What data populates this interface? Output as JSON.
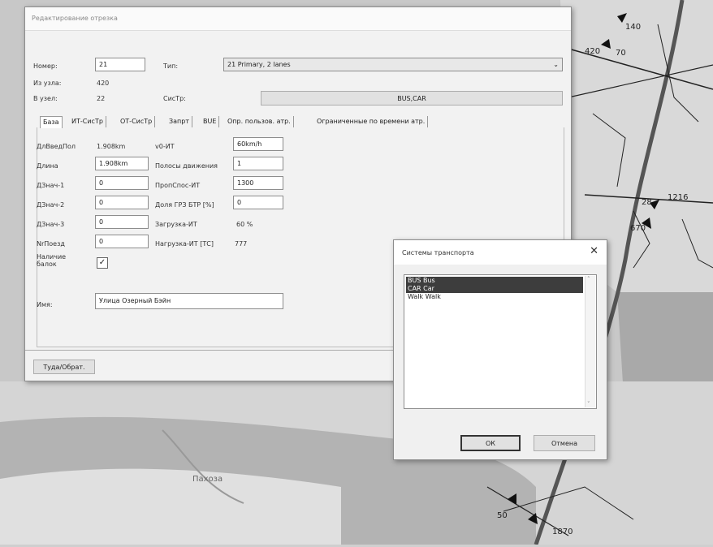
{
  "map": {
    "node_labels": [
      "140",
      "420",
      "1216",
      "670",
      "28",
      "70",
      "50",
      "1870"
    ],
    "place_label": "Пахоза"
  },
  "main_window": {
    "title": "Редактирование отрезка",
    "fields": {
      "number_label": "Номер:",
      "number_value": "21",
      "type_label": "Тип:",
      "type_value": "21 Primary, 2 lanes",
      "from_node_label": "Из узла:",
      "from_node_value": "420",
      "to_node_label": "В узел:",
      "to_node_value": "22",
      "systr_label": "СисТр:",
      "systr_value": "BUS,CAR"
    },
    "tabs": [
      "База",
      "ИТ-СисТр",
      "ОТ-СисТр",
      "Запрт",
      "BUE",
      "Опр. пользов. атр.",
      "Ограниченные по времени атр."
    ],
    "base": {
      "left": [
        {
          "label": "ДлВведПол",
          "value": "1.908km",
          "boxed": false
        },
        {
          "label": "Длина",
          "value": "1.908km",
          "boxed": true
        },
        {
          "label": "ДЗнач-1",
          "value": "0",
          "boxed": true
        },
        {
          "label": "ДЗнач-2",
          "value": "0",
          "boxed": true
        },
        {
          "label": "ДЗнач-3",
          "value": "0",
          "boxed": true
        },
        {
          "label": "NrПоезд",
          "value": "0",
          "boxed": true
        }
      ],
      "right": [
        {
          "label": "v0-ИТ",
          "value": "60km/h",
          "boxed": true
        },
        {
          "label": "Полосы движения",
          "value": "1",
          "boxed": true
        },
        {
          "label": "ПропСпос-ИТ",
          "value": "1300",
          "boxed": true
        },
        {
          "label": "Доля ГРЗ БТР [%]",
          "value": "0",
          "boxed": true
        },
        {
          "label": "Загрузка-ИТ",
          "value": "60 %",
          "boxed": false
        },
        {
          "label": "Нагрузка-ИТ [ТС]",
          "value": "777",
          "boxed": false
        }
      ],
      "checkbox_label": "Наличие балок",
      "checkbox_checked": true,
      "name_label": "Имя:",
      "name_value": "Улица Озерный Бэйн"
    },
    "back_forward_button": "Туда/Обрат."
  },
  "dialog": {
    "title": "Системы транспорта",
    "close_glyph": "✕",
    "items": [
      {
        "text": "BUS Bus",
        "selected": true
      },
      {
        "text": "CAR Car",
        "selected": true
      },
      {
        "text": "Walk Walk",
        "selected": false
      }
    ],
    "ok_label": "ОК",
    "cancel_label": "Отмена"
  }
}
